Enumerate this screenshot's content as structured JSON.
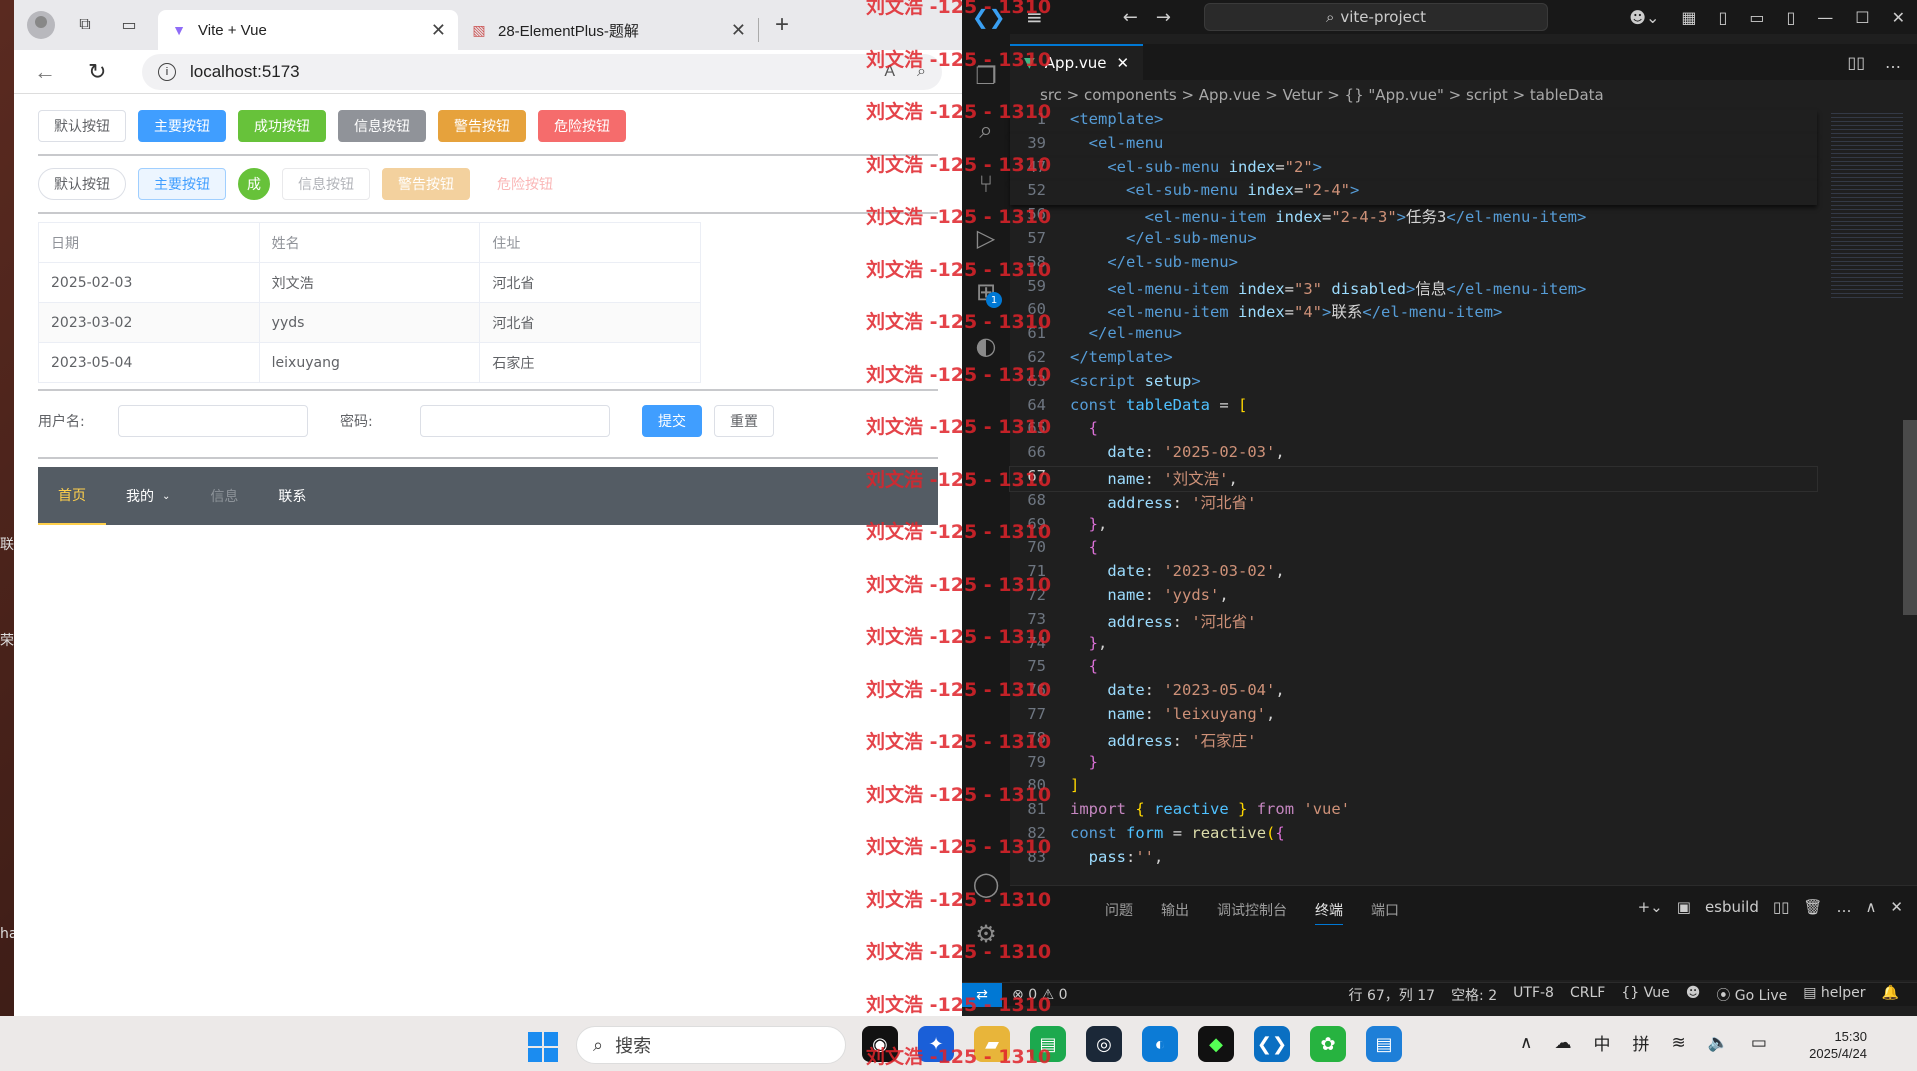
{
  "desktop": {
    "labels": [
      "联",
      "荣",
      "ha"
    ]
  },
  "browser": {
    "tabs": [
      {
        "title": "Vite + Vue",
        "active": true
      },
      {
        "title": "28-ElementPlus-题解",
        "active": false
      }
    ],
    "url": "localhost:5173"
  },
  "page": {
    "buttons_row1": [
      "默认按钮",
      "主要按钮",
      "成功按钮",
      "信息按钮",
      "警告按钮",
      "危险按钮"
    ],
    "buttons_row2": [
      "默认按钮",
      "主要按钮",
      "成",
      "信息按钮",
      "警告按钮",
      "危险按钮"
    ],
    "table": {
      "headers": [
        "日期",
        "姓名",
        "住址"
      ],
      "rows": [
        [
          "2025-02-03",
          "刘文浩",
          "河北省"
        ],
        [
          "2023-03-02",
          "yyds",
          "河北省"
        ],
        [
          "2023-05-04",
          "leixuyang",
          "石家庄"
        ]
      ]
    },
    "form": {
      "username_label": "用户名:",
      "password_label": "密码:",
      "submit_label": "提交",
      "reset_label": "重置"
    },
    "menu": {
      "items": [
        "首页",
        "我的",
        "信息",
        "联系"
      ]
    }
  },
  "watermark": "刘文浩 -125 - 1310",
  "vscode": {
    "command_center": "vite-project",
    "tab": "App.vue",
    "breadcrumb": "src > components > App.vue > Vetur > {} \"App.vue\" > script > tableData",
    "code": [
      {
        "n": "1",
        "html": "<span class='tag'>&lt;template&gt;</span>",
        "sticky": true
      },
      {
        "n": "39",
        "html": "  <span class='tag'>&lt;el-menu</span>",
        "sticky": true
      },
      {
        "n": "47",
        "html": "    <span class='tag'>&lt;el-sub-menu</span> <span class='attr'>index</span><span class='txt'>=</span><span class='str'>\"2\"</span><span class='tag'>&gt;</span>",
        "sticky": true
      },
      {
        "n": "52",
        "html": "      <span class='tag'>&lt;el-sub-menu</span> <span class='attr'>index</span><span class='txt'>=</span><span class='str'>\"2-4\"</span><span class='tag'>&gt;</span>",
        "sticky": true
      },
      {
        "n": "56",
        "html": "        <span class='tag'>&lt;el-menu-item</span> <span class='attr'>index</span><span class='txt'>=</span><span class='str'>\"2-4-3\"</span><span class='tag'>&gt;</span><span class='txt'>任务3</span><span class='tag'>&lt;/el-menu-item&gt;</span>"
      },
      {
        "n": "57",
        "html": "      <span class='tag'>&lt;/el-sub-menu&gt;</span>"
      },
      {
        "n": "58",
        "html": "    <span class='tag'>&lt;/el-sub-menu&gt;</span>"
      },
      {
        "n": "59",
        "html": "    <span class='tag'>&lt;el-menu-item</span> <span class='attr'>index</span><span class='txt'>=</span><span class='str'>\"3\"</span> <span class='attr'>disabled</span><span class='tag'>&gt;</span><span class='txt'>信息</span><span class='tag'>&lt;/el-menu-item&gt;</span>"
      },
      {
        "n": "60",
        "html": "    <span class='tag'>&lt;el-menu-item</span> <span class='attr'>index</span><span class='txt'>=</span><span class='str'>\"4\"</span><span class='tag'>&gt;</span><span class='txt'>联系</span><span class='tag'>&lt;/el-menu-item&gt;</span>"
      },
      {
        "n": "61",
        "html": "  <span class='tag'>&lt;/el-menu&gt;</span>"
      },
      {
        "n": "62",
        "html": "<span class='tag'>&lt;/template&gt;</span>"
      },
      {
        "n": "63",
        "html": "<span class='tag'>&lt;script</span> <span class='attr'>setup</span><span class='tag'>&gt;</span>"
      },
      {
        "n": "64",
        "html": "<span class='kw'>const</span> <span class='var'>tableData</span> <span class='txt'>=</span> <span class='br1'>[</span>"
      },
      {
        "n": "65",
        "html": "  <span class='br2'>{</span>"
      },
      {
        "n": "66",
        "html": "    <span class='attr'>date</span><span class='txt'>:</span> <span class='str'>'2025-02-03'</span><span class='txt'>,</span>"
      },
      {
        "n": "67",
        "html": "    <span class='attr'>name</span><span class='txt'>:</span> <span class='str'>'刘文浩'</span><span class='txt'>,</span>",
        "cur": true
      },
      {
        "n": "68",
        "html": "    <span class='attr'>address</span><span class='txt'>:</span> <span class='str'>'河北省'</span>"
      },
      {
        "n": "69",
        "html": "  <span class='br2'>}</span><span class='txt'>,</span>"
      },
      {
        "n": "70",
        "html": "  <span class='br2'>{</span>"
      },
      {
        "n": "71",
        "html": "    <span class='attr'>date</span><span class='txt'>:</span> <span class='str'>'2023-03-02'</span><span class='txt'>,</span>"
      },
      {
        "n": "72",
        "html": "    <span class='attr'>name</span><span class='txt'>:</span> <span class='str'>'yyds'</span><span class='txt'>,</span>"
      },
      {
        "n": "73",
        "html": "    <span class='attr'>address</span><span class='txt'>:</span> <span class='str'>'河北省'</span>"
      },
      {
        "n": "74",
        "html": "  <span class='br2'>}</span><span class='txt'>,</span>"
      },
      {
        "n": "75",
        "html": "  <span class='br2'>{</span>"
      },
      {
        "n": "76",
        "html": "    <span class='attr'>date</span><span class='txt'>:</span> <span class='str'>'2023-05-04'</span><span class='txt'>,</span>"
      },
      {
        "n": "77",
        "html": "    <span class='attr'>name</span><span class='txt'>:</span> <span class='str'>'leixuyang'</span><span class='txt'>,</span>"
      },
      {
        "n": "78",
        "html": "    <span class='attr'>address</span><span class='txt'>:</span> <span class='str'>'石家庄'</span>"
      },
      {
        "n": "79",
        "html": "  <span class='br2'>}</span>"
      },
      {
        "n": "80",
        "html": "<span class='br1'>]</span>"
      },
      {
        "n": "81",
        "html": "<span class='kw2'>import</span> <span class='br1'>{</span> <span class='var'>reactive</span> <span class='br1'>}</span> <span class='kw2'>from</span> <span class='str'>'vue'</span>"
      },
      {
        "n": "82",
        "html": "<span class='kw'>const</span> <span class='var'>form</span> <span class='txt'>=</span> <span class='fn'>reactive</span><span class='br1'>(</span><span class='br2'>{</span>"
      },
      {
        "n": "83",
        "html": "  <span class='attr'>pass</span><span class='txt'>:</span><span class='str'>''</span><span class='txt'>,</span>"
      }
    ],
    "panel_tabs": [
      "问题",
      "输出",
      "调试控制台",
      "终端",
      "端口"
    ],
    "panel_active": "终端",
    "terminal_name": "esbuild",
    "status": {
      "errors": "0",
      "warnings": "0",
      "position": "行 67，列 17",
      "spaces": "空格: 2",
      "encoding": "UTF-8",
      "eol": "CRLF",
      "language": "Vue",
      "golive": "Go Live",
      "helper": "helper"
    }
  },
  "taskbar": {
    "search": "搜索",
    "ime": "中",
    "ime2": "拼",
    "time": "15:30",
    "date": "2025/4/24"
  }
}
